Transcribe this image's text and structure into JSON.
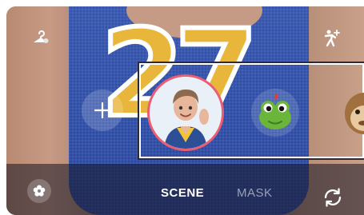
{
  "tabs": [
    {
      "label": "SCENE",
      "selected": true
    },
    {
      "label": "MASK",
      "selected": false
    }
  ],
  "icons": {
    "top_left": "hanger-icon",
    "top_right": "pose-icon",
    "add": "plus-icon",
    "bottom_left": "flower-effect-icon",
    "bottom_right": "switch-camera-icon"
  },
  "stickers": [
    {
      "name": "my-avatar",
      "selected": true
    },
    {
      "name": "frog"
    },
    {
      "name": "monkey"
    }
  ],
  "colors": {
    "selection_ring": "#ea5d72",
    "tab_active": "#ffffff",
    "tab_inactive": "#9aa0b8"
  }
}
